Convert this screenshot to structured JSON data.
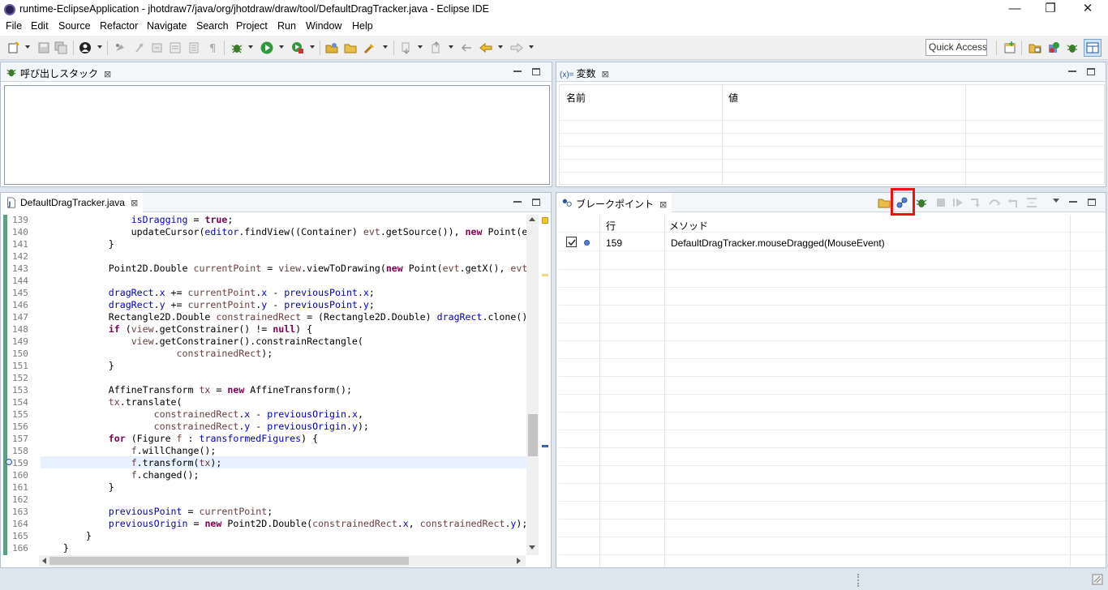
{
  "window": {
    "title": "runtime-EclipseApplication - jhotdraw7/java/org/jhotdraw/draw/tool/DefaultDragTracker.java - Eclipse IDE",
    "minimize": "—",
    "restore": "❐",
    "close": "✕"
  },
  "menu": [
    "File",
    "Edit",
    "Source",
    "Refactor",
    "Navigate",
    "Search",
    "Project",
    "Run",
    "Window",
    "Help"
  ],
  "toolbar": {
    "quick_access": "Quick Access"
  },
  "callstack": {
    "tab_label": "呼び出しスタック",
    "close": "⊠"
  },
  "variables": {
    "tab_prefix": "(x)=",
    "tab_label": "変数",
    "close": "⊠",
    "col_name": "名前",
    "col_value": "値"
  },
  "editor": {
    "tab_label": "DefaultDragTracker.java",
    "close": "⊠",
    "lines": [
      {
        "n": "139",
        "html": "                <span class='fld'>isDragging</span> = <span class='kw'>true</span>;"
      },
      {
        "n": "140",
        "html": "                updateCursor(<span class='fld'>editor</span>.findView((Container) <span class='loc'>evt</span>.getSource()), <span class='kw'>new</span> Point(e"
      },
      {
        "n": "141",
        "html": "            }"
      },
      {
        "n": "142",
        "html": ""
      },
      {
        "n": "143",
        "html": "            Point2D.Double <span class='loc'>currentPoint</span> = <span class='loc'>view</span>.viewToDrawing(<span class='kw'>new</span> Point(<span class='loc'>evt</span>.getX(), <span class='loc'>evt</span>"
      },
      {
        "n": "144",
        "html": ""
      },
      {
        "n": "145",
        "html": "            <span class='fld'>dragRect</span>.<span class='fld'>x</span> += <span class='loc'>currentPoint</span>.<span class='fld'>x</span> - <span class='fld'>previousPoint</span>.<span class='fld'>x</span>;"
      },
      {
        "n": "146",
        "html": "            <span class='fld'>dragRect</span>.<span class='fld'>y</span> += <span class='loc'>currentPoint</span>.<span class='fld'>y</span> - <span class='fld'>previousPoint</span>.<span class='fld'>y</span>;"
      },
      {
        "n": "147",
        "html": "            Rectangle2D.Double <span class='loc'>constrainedRect</span> = (Rectangle2D.Double) <span class='fld'>dragRect</span>.clone()"
      },
      {
        "n": "148",
        "html": "            <span class='kw'>if</span> (<span class='loc'>view</span>.getConstrainer() != <span class='kw'>null</span>) {"
      },
      {
        "n": "149",
        "html": "                <span class='loc'>view</span>.getConstrainer().constrainRectangle("
      },
      {
        "n": "150",
        "html": "                        <span class='loc'>constrainedRect</span>);"
      },
      {
        "n": "151",
        "html": "            }"
      },
      {
        "n": "152",
        "html": ""
      },
      {
        "n": "153",
        "html": "            AffineTransform <span class='loc'>tx</span> = <span class='kw'>new</span> AffineTransform();"
      },
      {
        "n": "154",
        "html": "            <span class='loc'>tx</span>.translate("
      },
      {
        "n": "155",
        "html": "                    <span class='loc'>constrainedRect</span>.<span class='fld'>x</span> - <span class='fld'>previousOrigin</span>.<span class='fld'>x</span>,"
      },
      {
        "n": "156",
        "html": "                    <span class='loc'>constrainedRect</span>.<span class='fld'>y</span> - <span class='fld'>previousOrigin</span>.<span class='fld'>y</span>);"
      },
      {
        "n": "157",
        "html": "            <span class='kw'>for</span> (Figure <span class='loc'>f</span> : <span class='fld'>transformedFigures</span>) {"
      },
      {
        "n": "158",
        "html": "                <span class='loc'>f</span>.willChange();"
      },
      {
        "n": "159",
        "html": "                <span class='loc'>f</span>.transform(<span class='loc'>tx</span>);"
      },
      {
        "n": "160",
        "html": "                <span class='loc'>f</span>.changed();"
      },
      {
        "n": "161",
        "html": "            }"
      },
      {
        "n": "162",
        "html": ""
      },
      {
        "n": "163",
        "html": "            <span class='fld'>previousPoint</span> = <span class='loc'>currentPoint</span>;"
      },
      {
        "n": "164",
        "html": "            <span class='fld'>previousOrigin</span> = <span class='kw'>new</span> Point2D.Double(<span class='loc'>constrainedRect</span>.<span class='fld'>x</span>, <span class='loc'>constrainedRect</span>.<span class='fld'>y</span>);"
      },
      {
        "n": "165",
        "html": "        }"
      },
      {
        "n": "166",
        "html": "    }"
      }
    ]
  },
  "breakpoints": {
    "tab_label": "ブレークポイント",
    "close": "⊠",
    "col_line": "行",
    "col_method": "メソッド",
    "rows": [
      {
        "checked": true,
        "line": "159",
        "method": "DefaultDragTracker.mouseDragged(MouseEvent)"
      }
    ]
  },
  "colors": {
    "accent": "#2b5797",
    "highlight": "#e11111",
    "keyword": "#7f0055",
    "field": "#0000c0"
  }
}
